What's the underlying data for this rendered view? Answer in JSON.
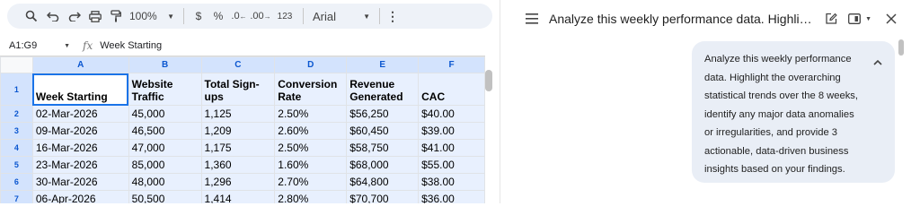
{
  "toolbar": {
    "zoom": "100%",
    "currency": "$",
    "percent": "%",
    "dec_decrease": ".0",
    "dec_increase": ".00",
    "number_format": "123",
    "font": "Arial"
  },
  "namebar": {
    "cell_ref": "A1:G9",
    "formula": "Week Starting"
  },
  "sheet": {
    "columns": [
      "A",
      "B",
      "C",
      "D",
      "E",
      "F"
    ],
    "row_numbers": [
      "1",
      "2",
      "3",
      "4",
      "5",
      "6",
      "7"
    ],
    "header": [
      "Week Starting",
      "Website Traffic",
      "Total Sign-ups",
      "Conversion Rate",
      "Revenue Generated",
      "CAC"
    ],
    "rows": [
      [
        "02-Mar-2026",
        "45,000",
        "1,125",
        "2.50%",
        "$56,250",
        "$40.00"
      ],
      [
        "09-Mar-2026",
        "46,500",
        "1,209",
        "2.60%",
        "$60,450",
        "$39.00"
      ],
      [
        "16-Mar-2026",
        "47,000",
        "1,175",
        "2.50%",
        "$58,750",
        "$41.00"
      ],
      [
        "23-Mar-2026",
        "85,000",
        "1,360",
        "1.60%",
        "$68,000",
        "$55.00"
      ],
      [
        "30-Mar-2026",
        "48,000",
        "1,296",
        "2.70%",
        "$64,800",
        "$38.00"
      ],
      [
        "06-Apr-2026",
        "50,500",
        "1,414",
        "2.80%",
        "$70,700",
        "$36.00"
      ]
    ]
  },
  "chat": {
    "title": "Analyze this weekly performance data. Highlight the overarching statistical trends over the 8 weeks, identify any major data anomalies or irregularities, and provide 3 actionable, data-driven business insights based on your findings.",
    "message": "Analyze this weekly performance data. Highlight the overarching statistical trends over the 8 weeks, identify any major data anomalies or irregularities, and provide 3 actionable, data-driven business insights based on your findings."
  }
}
